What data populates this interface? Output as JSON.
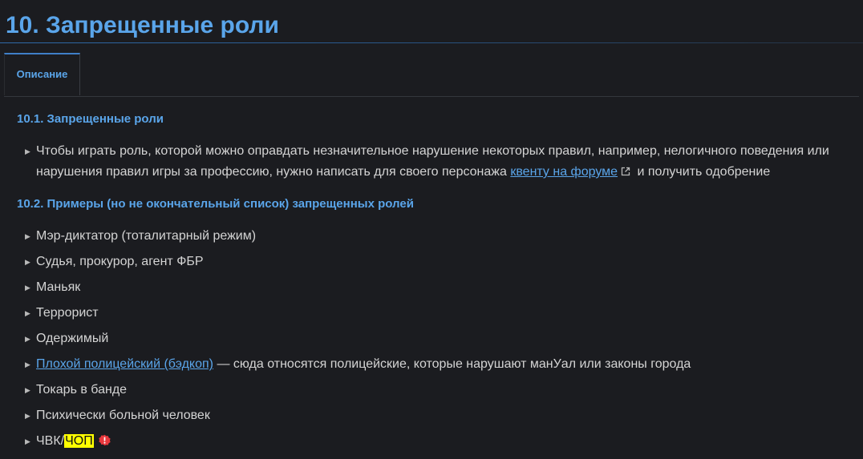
{
  "page": {
    "title": "10. Запрещенные роли"
  },
  "tabs": [
    {
      "label": "Описание",
      "active": true
    }
  ],
  "sections": [
    {
      "heading": "10.1. Запрещенные роли",
      "items": [
        {
          "line1": "Чтобы играть роль, которой можно оправдать незначительное нарушение некоторых правил, например, нелогичного поведения или",
          "line2_before": "нарушения правил игры за профессию, нужно написать для своего персонажа",
          "line2_link": "квенту на форуме",
          "line2_after": "и получить одобрение"
        }
      ]
    },
    {
      "heading": "10.2. Примеры (но не окончательный список) запрещенных ролей",
      "items": [
        {
          "text": "Мэр-диктатор (тоталитарный режим)"
        },
        {
          "text": "Судья, прокурор, агент ФБР"
        },
        {
          "text": "Маньяк"
        },
        {
          "text": "Террорист"
        },
        {
          "text": "Одержимый"
        },
        {
          "link": "Плохой полицейский (бэдкоп)",
          "text": " — сюда относятся полицейские, которые нарушают манУал или законы города"
        },
        {
          "text": "Токарь в банде"
        },
        {
          "text": "Психически больной человек"
        },
        {
          "text": "ЧВК/",
          "highlight": "ЧОП"
        }
      ]
    }
  ],
  "colors": {
    "background": "#1b1c20",
    "accent": "#5aa5ea",
    "text": "#d4d4d4",
    "highlight": "#ffff00",
    "warning": "#e8383d"
  },
  "icons": {
    "bullet": "triangle-right-icon",
    "external_link": "external-link-icon",
    "warning": "warning-badge-icon"
  }
}
